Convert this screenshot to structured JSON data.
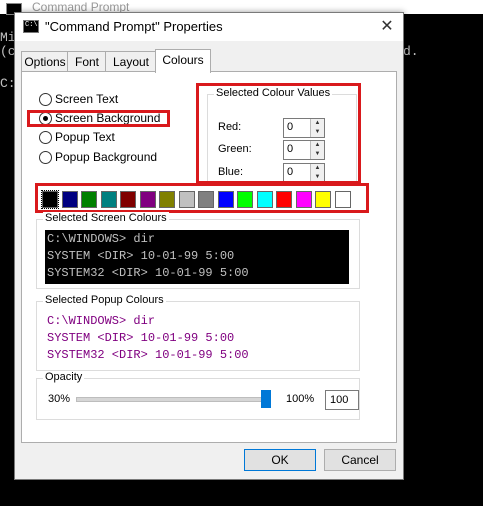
{
  "background": {
    "title": "Command Prompt",
    "lines": [
      "Mi",
      "(c",
      "d.",
      "C:"
    ]
  },
  "dialog": {
    "title": "\"Command Prompt\" Properties",
    "close_glyph": "✕",
    "tabs": [
      "Options",
      "Font",
      "Layout",
      "Colours"
    ],
    "active_tab": "Colours"
  },
  "colour_targets": {
    "options": [
      "Screen Text",
      "Screen Background",
      "Popup Text",
      "Popup Background"
    ],
    "selected": "Screen Background"
  },
  "selected_colour_values": {
    "title": "Selected Colour Values",
    "red_label": "Red:",
    "green_label": "Green:",
    "blue_label": "Blue:",
    "red": "0",
    "green": "0",
    "blue": "0"
  },
  "palette": {
    "colors": [
      "#000000",
      "#000080",
      "#008000",
      "#008080",
      "#800000",
      "#800080",
      "#808000",
      "#c0c0c0",
      "#808080",
      "#0000ff",
      "#00ff00",
      "#00ffff",
      "#ff0000",
      "#ff00ff",
      "#ffff00",
      "#ffffff"
    ],
    "selected_index": 0
  },
  "screen_preview": {
    "title": "Selected Screen Colours",
    "lines": [
      "C:\\WINDOWS> dir",
      "SYSTEM         <DIR>      10-01-99    5:00",
      "SYSTEM32       <DIR>      10-01-99    5:00"
    ],
    "text_color": "#c0c0c0",
    "bg_color": "#000000"
  },
  "popup_preview": {
    "title": "Selected Popup Colours",
    "lines": [
      "C:\\WINDOWS> dir",
      "SYSTEM         <DIR>      10-01-99    5:00",
      "SYSTEM32       <DIR>      10-01-99    5:00"
    ],
    "text_color": "#800080",
    "bg_color": "#ffffff"
  },
  "opacity": {
    "title": "Opacity",
    "min_label": "30%",
    "max_label": "100%",
    "value": "100",
    "level_percent": 100
  },
  "buttons": {
    "ok": "OK",
    "cancel": "Cancel"
  },
  "highlight_color": "#d9191c"
}
